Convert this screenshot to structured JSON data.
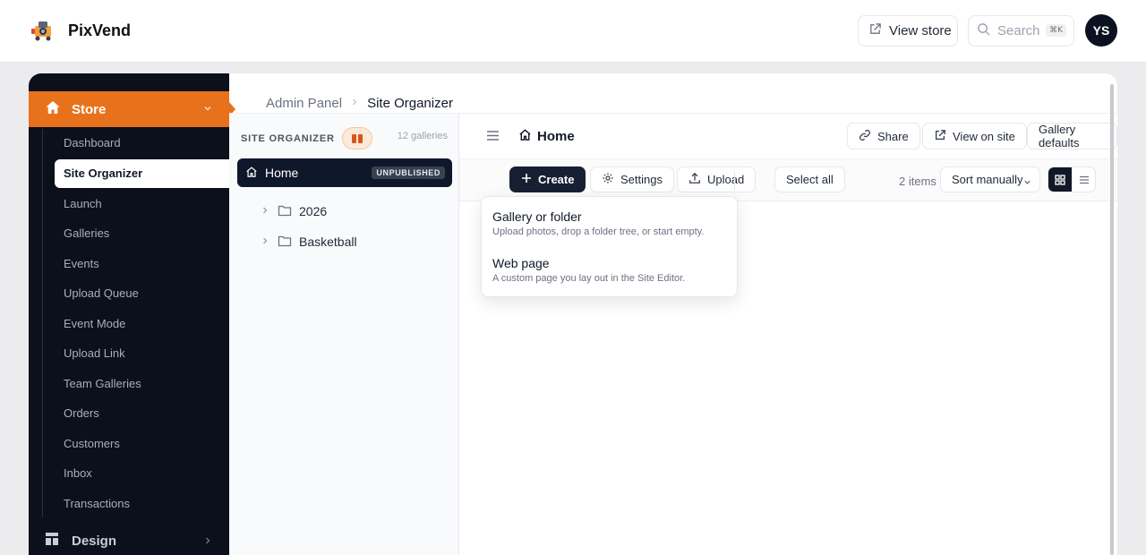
{
  "app": {
    "name": "PixVend"
  },
  "topbar": {
    "view_store": "View store",
    "search_placeholder": "Search",
    "search_shortcut": "⌘K",
    "avatar_initials": "YS"
  },
  "sidebar": {
    "store_label": "Store",
    "items": [
      "Dashboard",
      "Site Organizer",
      "Launch",
      "Galleries",
      "Events",
      "Upload Queue",
      "Event Mode",
      "Upload Link",
      "Team Galleries",
      "Orders",
      "Customers",
      "Inbox",
      "Transactions"
    ],
    "active_item": "Site Organizer",
    "design_label": "Design"
  },
  "breadcrumb": [
    "Admin Panel",
    "Site Organizer"
  ],
  "tree": {
    "heading": "SITE ORGANIZER",
    "count": "12 galleries",
    "root": {
      "label": "Home",
      "badge": "UNPUBLISHED"
    },
    "folders": [
      "2026",
      "Basketball"
    ]
  },
  "content": {
    "title": "Home",
    "share": "Share",
    "view_on_site": "View on site",
    "gallery_defaults": "Gallery defaults",
    "toolbar": {
      "create": "Create",
      "settings": "Settings",
      "upload": "Upload",
      "select_all": "Select all",
      "items_count": "2 items",
      "sort": "Sort manually",
      "view_mode": "grid"
    }
  },
  "create_menu": [
    {
      "title": "Gallery or folder",
      "subtitle": "Upload photos, drop a folder tree, or start empty."
    },
    {
      "title": "Web page",
      "subtitle": "A custom page you lay out in the Site Editor."
    }
  ],
  "colors": {
    "accent": "#e8721c",
    "sidebar_bg": "#0b101b",
    "primary_dark": "#172033"
  }
}
